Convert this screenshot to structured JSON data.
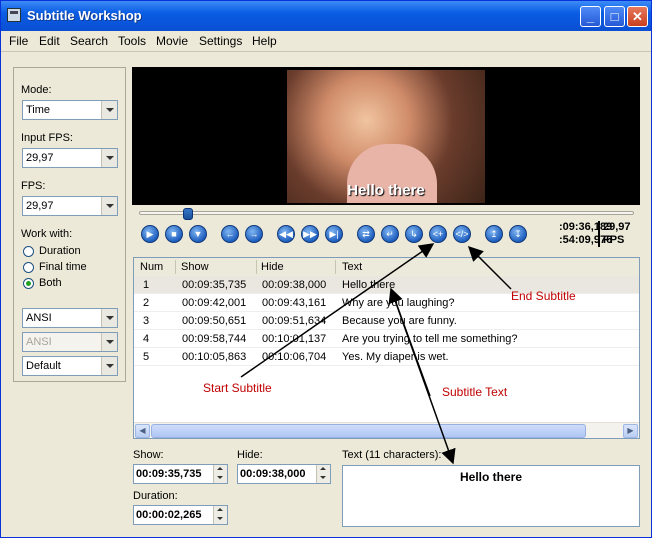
{
  "window": {
    "title": "Subtitle Workshop"
  },
  "menu": [
    "File",
    "Edit",
    "Search",
    "Tools",
    "Movie",
    "Settings",
    "Help"
  ],
  "left_panel": {
    "mode_label": "Mode:",
    "mode_value": "Time",
    "input_fps_label": "Input FPS:",
    "input_fps_value": "29,97",
    "fps_label": "FPS:",
    "fps_value": "29,97",
    "work_with_label": "Work with:",
    "work_with_options": [
      "Duration",
      "Final time",
      "Both"
    ],
    "work_with_selected": "Both",
    "charset_value": "ANSI",
    "charset2_value": "ANSI",
    "style_value": "Default"
  },
  "player": {
    "subtitle_overlay": "Hello there",
    "slider_position": 0.09,
    "current_time": ":09:36,189",
    "total_time": ":54:09,976",
    "fps_value": "29,97",
    "fps_unit": "FPS"
  },
  "table": {
    "columns": [
      "Num",
      "Show",
      "Hide",
      "Text"
    ],
    "rows": [
      {
        "num": "1",
        "show": "00:09:35,735",
        "hide": "00:09:38,000",
        "text": "Hello there"
      },
      {
        "num": "2",
        "show": "00:09:42,001",
        "hide": "00:09:43,161",
        "text": "Why are you laughing?"
      },
      {
        "num": "3",
        "show": "00:09:50,651",
        "hide": "00:09:51,634",
        "text": "Because you are funny."
      },
      {
        "num": "4",
        "show": "00:09:58,744",
        "hide": "00:10:01,137",
        "text": "Are you trying to tell me something?"
      },
      {
        "num": "5",
        "show": "00:10:05,863",
        "hide": "00:10:06,704",
        "text": "Yes. My diaper is wet."
      }
    ]
  },
  "editor": {
    "show_label": "Show:",
    "show_value": "00:09:35,735",
    "hide_label": "Hide:",
    "hide_value": "00:09:38,000",
    "duration_label": "Duration:",
    "duration_value": "00:00:02,265",
    "text_label": "Text (11 characters):",
    "text_value": "Hello there"
  },
  "annotations": {
    "start_subtitle": "Start Subtitle",
    "end_subtitle": "End Subtitle",
    "subtitle_text": "Subtitle Text",
    "color": "#c00000"
  }
}
